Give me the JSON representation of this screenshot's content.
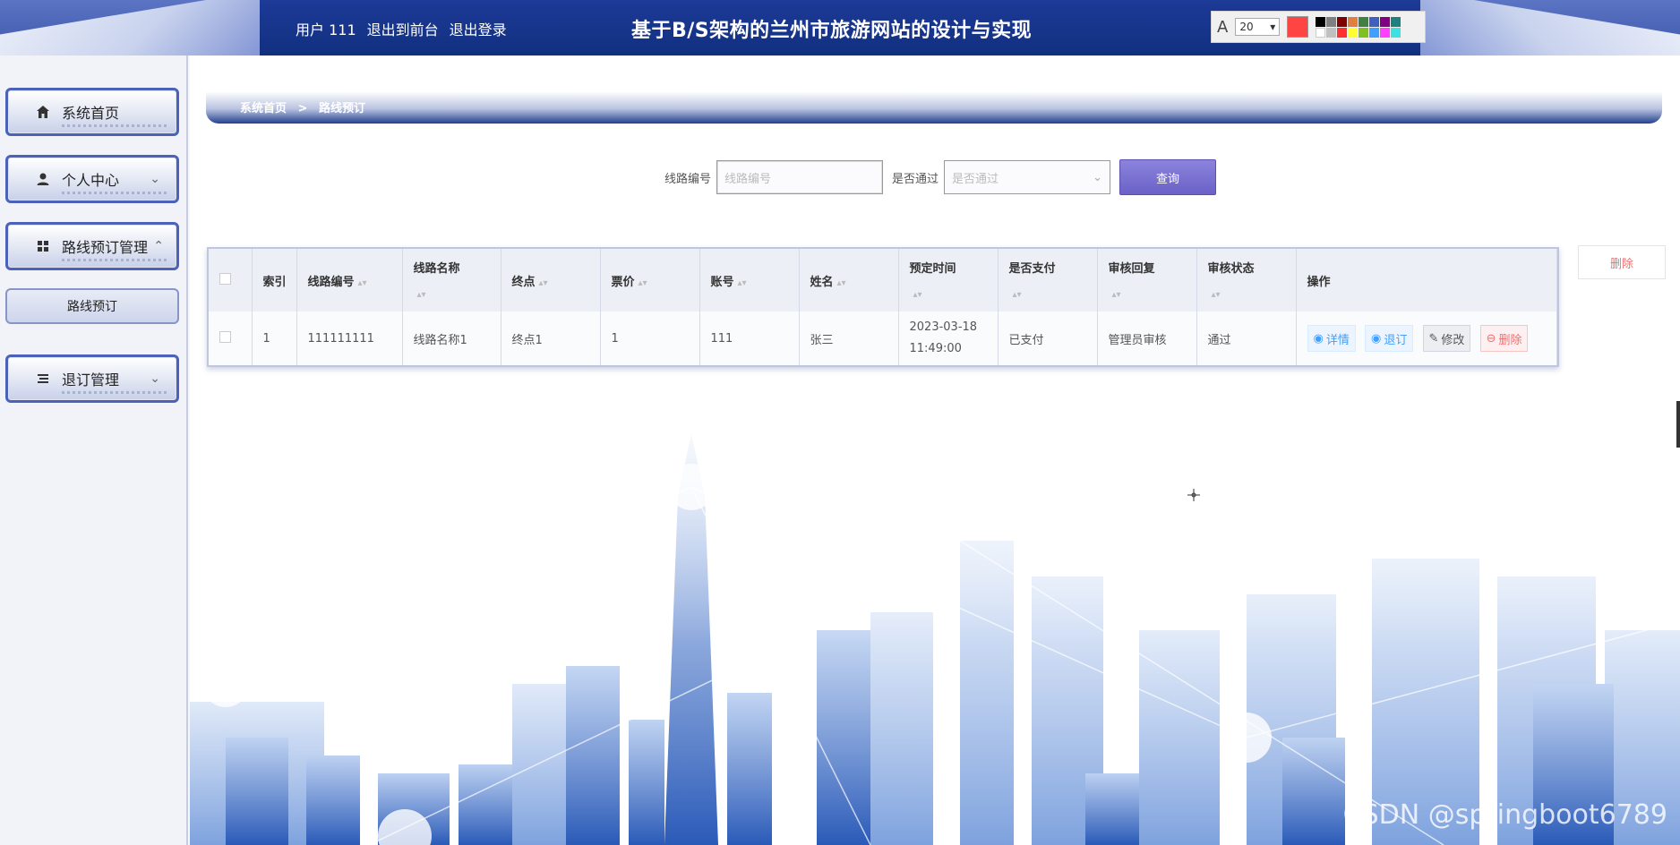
{
  "header": {
    "user_label": "用户 111",
    "to_front": "退出到前台",
    "logout": "退出登录",
    "site_title": "基于B/S架构的兰州市旅游网站的设计与实现"
  },
  "annot_toolbar": {
    "font_size": "20",
    "current_color": "#ff4444"
  },
  "sidebar": {
    "items": [
      {
        "label": "系统首页",
        "icon": "home-icon"
      },
      {
        "label": "个人中心",
        "icon": "user-icon"
      },
      {
        "label": "路线预订管理",
        "icon": "grid-icon"
      },
      {
        "label": "退订管理",
        "icon": "list-icon"
      }
    ],
    "submenu": {
      "label": "路线预订"
    }
  },
  "breadcrumb": {
    "home": "系统首页",
    "sep": ">",
    "current": "路线预订"
  },
  "search": {
    "route_no_label": "线路编号",
    "route_no_placeholder": "线路编号",
    "passed_label": "是否通过",
    "passed_placeholder": "是否通过",
    "query_button": "查询"
  },
  "delete_button": "删除",
  "table": {
    "headers": [
      "索引",
      "线路编号",
      "线路名称",
      "终点",
      "票价",
      "账号",
      "姓名",
      "预定时间",
      "是否支付",
      "审核回复",
      "审核状态",
      "操作"
    ],
    "rows": [
      {
        "index": "1",
        "route_no": "111111111",
        "route_name": "线路名称1",
        "destination": "终点1",
        "price": "1",
        "account": "111",
        "name": "张三",
        "booking_date": "2023-03-18",
        "booking_time": "11:49:00",
        "paid": "已支付",
        "reply": "管理员审核",
        "status": "通过"
      }
    ],
    "actions": {
      "detail": "详情",
      "cancel": "退订",
      "edit": "修改",
      "delete": "删除"
    }
  },
  "watermark": "CSDN @springboot6789"
}
